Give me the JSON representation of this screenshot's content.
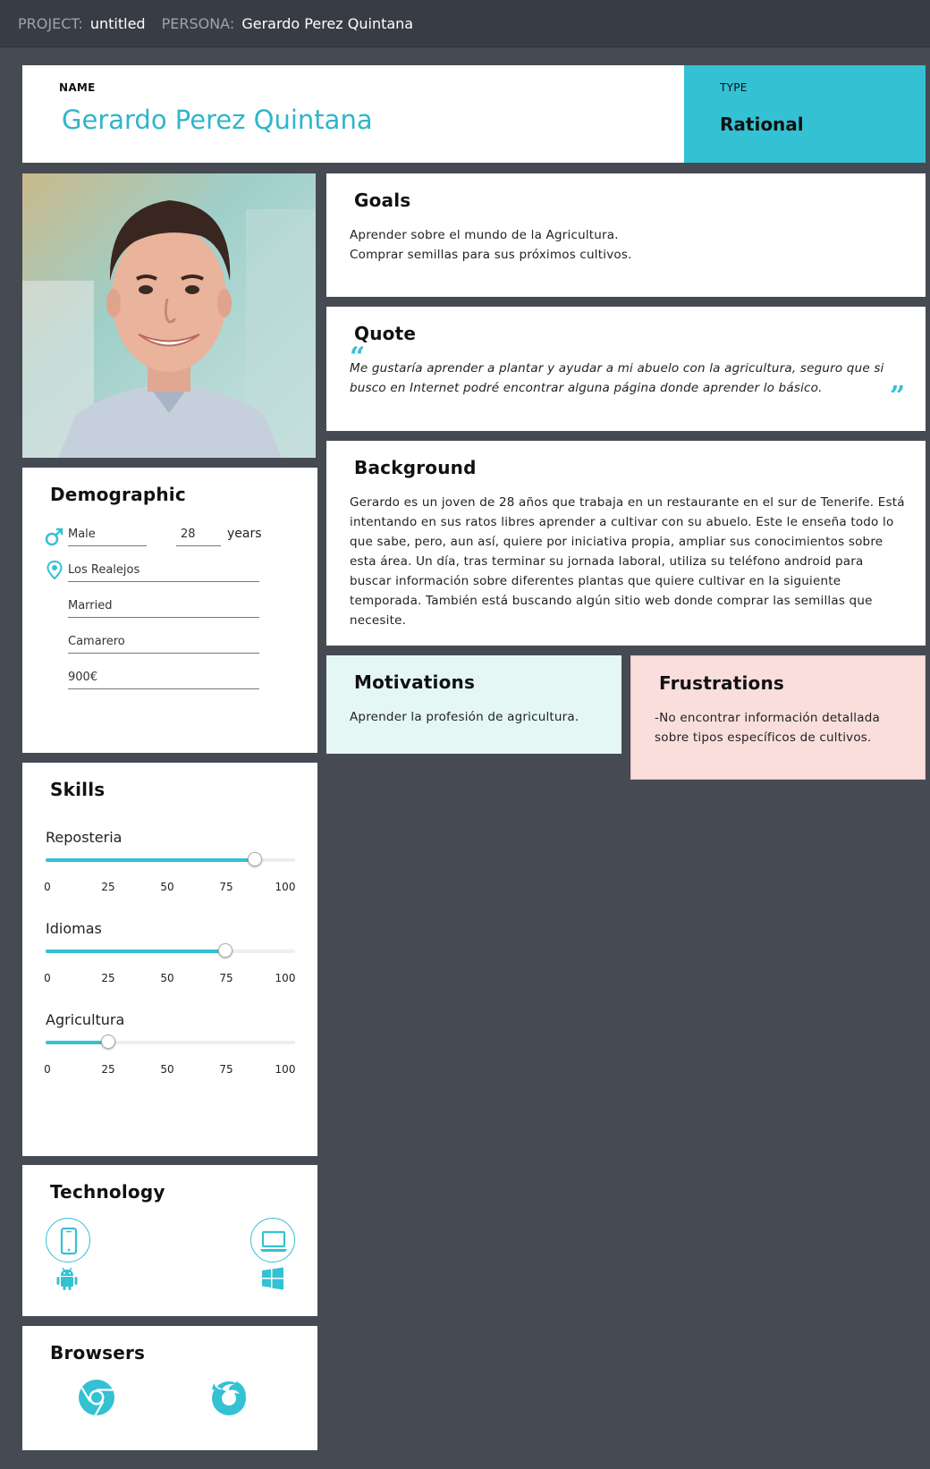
{
  "topbar": {
    "project_label": "PROJECT:",
    "project_value": "untitled",
    "persona_label": "PERSONA:",
    "persona_value": "Gerardo Perez Quintana"
  },
  "header": {
    "name_label": "NAME",
    "name_value": "Gerardo Perez Quintana",
    "type_label": "TYPE",
    "type_value": "Rational"
  },
  "demographic": {
    "title": "Demographic",
    "gender": "Male",
    "age": "28",
    "age_unit": "years",
    "location": "Los Realejos",
    "marital_status": "Married",
    "occupation": "Camarero",
    "income": "900€"
  },
  "goals": {
    "title": "Goals",
    "lines": [
      "Aprender sobre el mundo de la Agricultura.",
      "Comprar semillas para sus próximos cultivos."
    ]
  },
  "quote": {
    "title": "Quote",
    "text": "Me gustaría aprender a plantar y ayudar a mi abuelo con la agricultura, seguro que si busco en Internet podré encontrar alguna página donde aprender lo básico."
  },
  "background": {
    "title": "Background",
    "text": "Gerardo es un joven de 28 años que trabaja en un restaurante en el sur de Tenerife. Está intentando en sus ratos libres aprender a cultivar con su abuelo. Este le enseña todo lo que sabe, pero, aun así, quiere por iniciativa propia, ampliar sus conocimientos sobre esta área. Un día, tras terminar su jornada laboral, utiliza su teléfono android para buscar información sobre diferentes plantas que quiere cultivar en la siguiente temporada. También está buscando algún sitio web donde comprar las semillas que necesite."
  },
  "motivations": {
    "title": "Motivations",
    "text": "Aprender la profesión de agricultura."
  },
  "frustrations": {
    "title": "Frustrations",
    "text": "-No encontrar información detallada sobre tipos específicos de cultivos."
  },
  "skills": {
    "title": "Skills",
    "ticks": [
      "0",
      "25",
      "50",
      "75",
      "100"
    ],
    "items": [
      {
        "name": "Reposteria",
        "value": 84
      },
      {
        "name": "Idiomas",
        "value": 72
      },
      {
        "name": "Agricultura",
        "value": 25
      }
    ]
  },
  "technology": {
    "title": "Technology",
    "devices": [
      "smartphone-icon",
      "laptop-icon"
    ],
    "platforms": [
      "android-icon",
      "windows-icon"
    ]
  },
  "browsers": {
    "title": "Browsers",
    "items": [
      "chrome-icon",
      "firefox-icon"
    ]
  },
  "colors": {
    "accent": "#34c1d3",
    "page_bg": "#464a52",
    "motivation_bg": "#e4f7f4",
    "frustration_bg": "#f9dedc"
  }
}
